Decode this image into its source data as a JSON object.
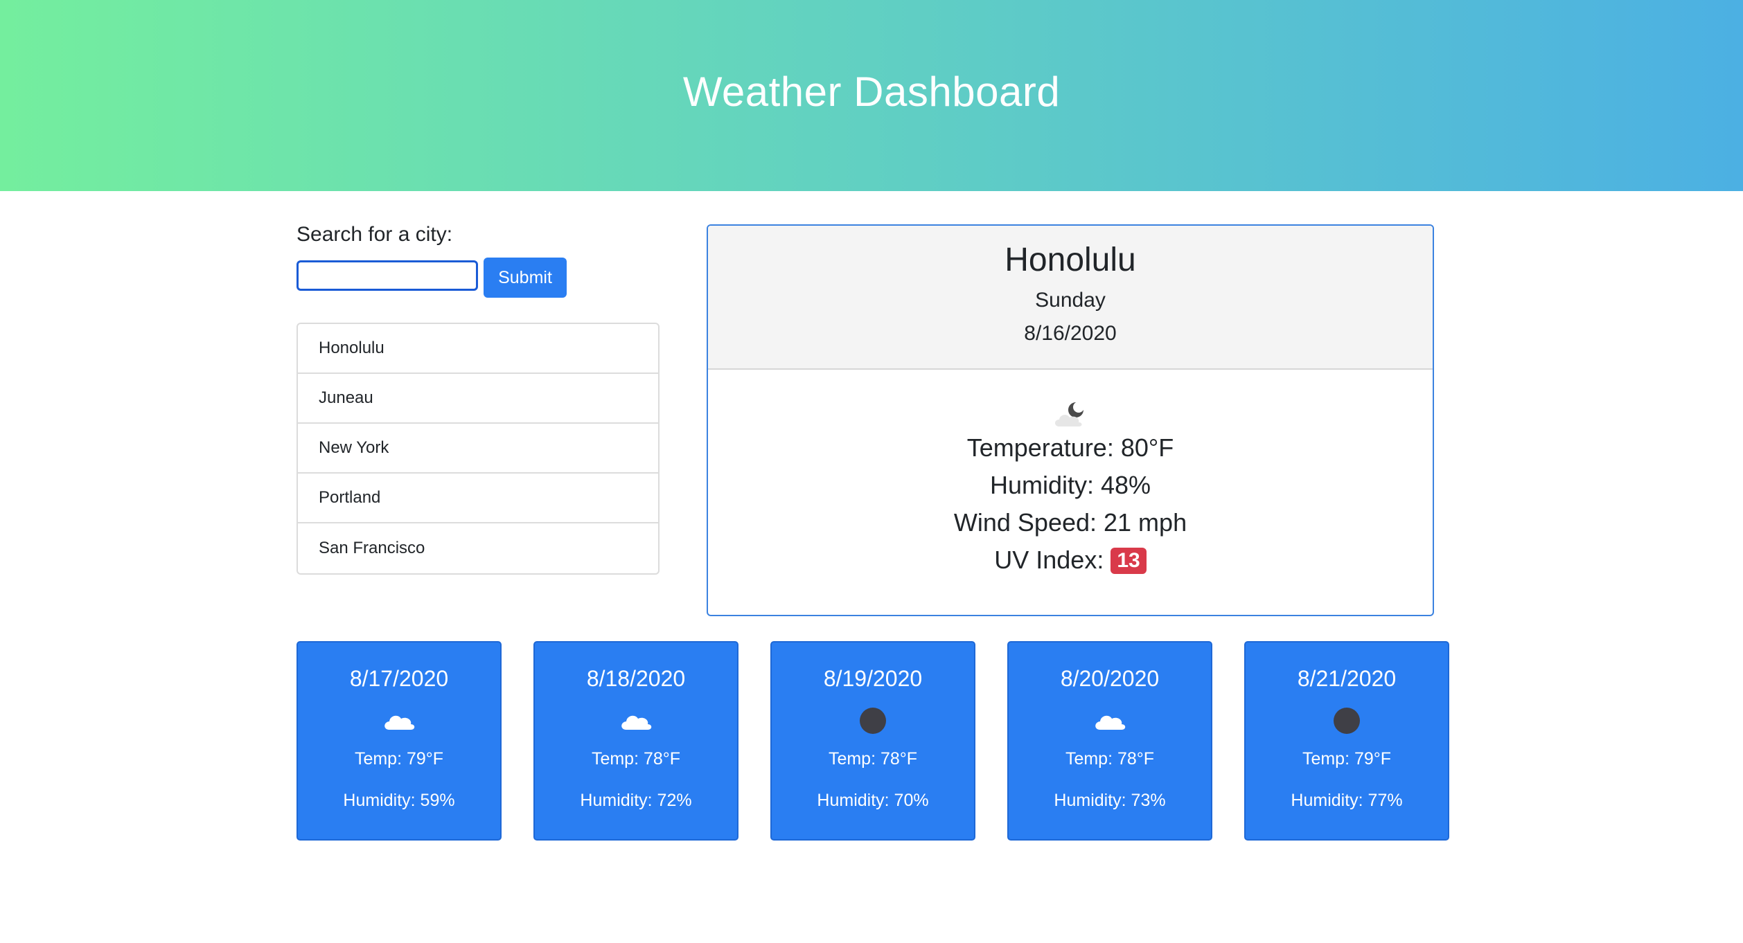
{
  "header": {
    "title": "Weather Dashboard"
  },
  "search": {
    "label": "Search for a city:",
    "value": "",
    "placeholder": "",
    "submit_label": "Submit"
  },
  "history": [
    "Honolulu",
    "Juneau",
    "New York",
    "Portland",
    "San Francisco"
  ],
  "current": {
    "city": "Honolulu",
    "day": "Sunday",
    "date": "8/16/2020",
    "icon": "partly-cloudy-night-icon",
    "temperature": "Temperature: 80°F",
    "humidity": "Humidity: 48%",
    "wind": "Wind Speed: 21 mph",
    "uv_label": "UV Index:",
    "uv_value": "13",
    "uv_color": "#d93a4a"
  },
  "forecast": [
    {
      "date": "8/17/2020",
      "icon": "cloud-icon",
      "temp": "Temp: 79°F",
      "humidity": "Humidity: 59%"
    },
    {
      "date": "8/18/2020",
      "icon": "cloud-icon",
      "temp": "Temp: 78°F",
      "humidity": "Humidity: 72%"
    },
    {
      "date": "8/19/2020",
      "icon": "clear-night-icon",
      "temp": "Temp: 78°F",
      "humidity": "Humidity: 70%"
    },
    {
      "date": "8/20/2020",
      "icon": "cloud-icon",
      "temp": "Temp: 78°F",
      "humidity": "Humidity: 73%"
    },
    {
      "date": "8/21/2020",
      "icon": "clear-night-icon",
      "temp": "Temp: 79°F",
      "humidity": "Humidity: 77%"
    }
  ],
  "colors": {
    "header_gradient_start": "#74ee9e",
    "header_gradient_end": "#4cb0e3",
    "primary": "#2a7ef2",
    "danger": "#d93a4a"
  }
}
